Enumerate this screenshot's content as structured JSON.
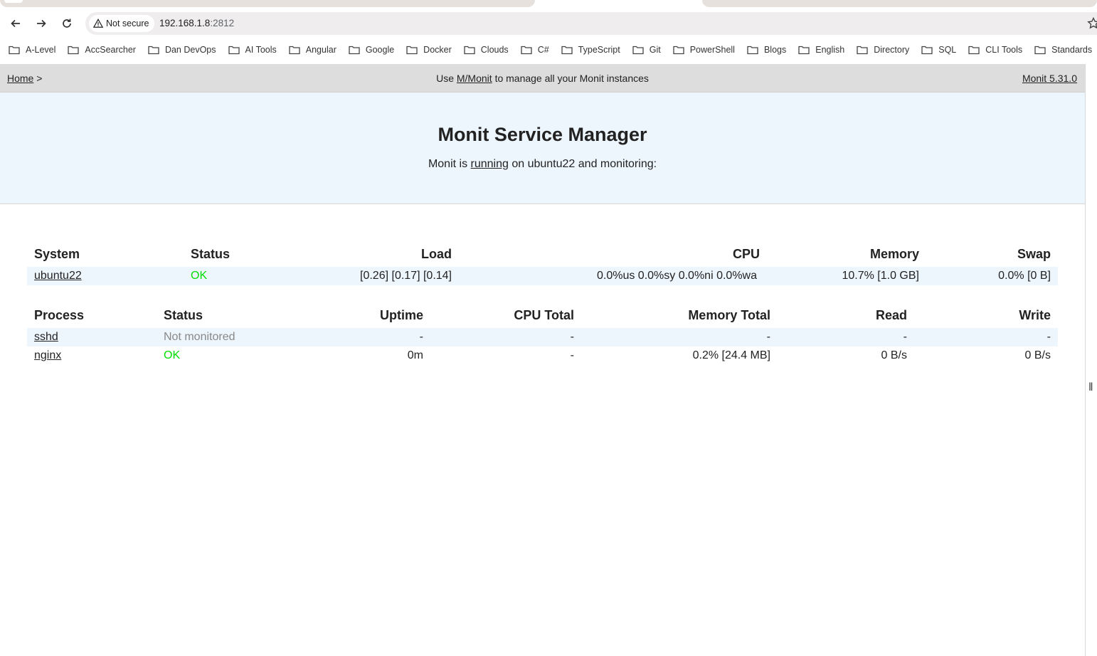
{
  "browser": {
    "security_label": "Not secure",
    "url_host": "192.168.1.8",
    "url_port": ":2812",
    "bookmarks": [
      "A-Level",
      "AccSearcher",
      "Dan DevOps",
      "AI Tools",
      "Angular",
      "Google",
      "Docker",
      "Clouds",
      "C#",
      "TypeScript",
      "Git",
      "PowerShell",
      "Blogs",
      "English",
      "Directory",
      "SQL",
      "CLI Tools",
      "Standards"
    ],
    "bookmark_extra": "ꝏ"
  },
  "topbar": {
    "home_link": "Home",
    "separator": ">",
    "message_prefix": "Use",
    "mmonit_link": "M/Monit",
    "message_suffix": "to manage all your Monit instances",
    "version_link": "Monit 5.31.0"
  },
  "hero": {
    "title": "Monit Service Manager",
    "text_prefix": "Monit is",
    "running_link": "running",
    "text_suffix": "on ubuntu22 and monitoring:"
  },
  "system_table": {
    "headers": [
      "System",
      "Status",
      "Load",
      "CPU",
      "Memory",
      "Swap"
    ],
    "row": {
      "name": "ubuntu22",
      "status": "OK",
      "load": "[0.26] [0.17] [0.14]",
      "cpu": "0.0%us 0.0%sy 0.0%ni 0.0%wa",
      "memory": "10.7% [1.0 GB]",
      "swap": "0.0% [0 B]"
    }
  },
  "process_table": {
    "headers": [
      "Process",
      "Status",
      "Uptime",
      "CPU Total",
      "Memory Total",
      "Read",
      "Write"
    ],
    "rows": [
      {
        "name": "sshd",
        "status": "Not monitored",
        "uptime": "-",
        "cpu_total": "-",
        "memory_total": "-",
        "read": "-",
        "write": "-"
      },
      {
        "name": "nginx",
        "status": "OK",
        "uptime": "0m",
        "cpu_total": "-",
        "memory_total": "0.2% [24.4 MB]",
        "read": "0 B/s",
        "write": "0 B/s"
      }
    ]
  },
  "colors": {
    "status_ok": "#00dd00",
    "status_not_monitored": "#888888",
    "hero_background": "#edf5fd",
    "topbar_background": "#dddddd"
  }
}
